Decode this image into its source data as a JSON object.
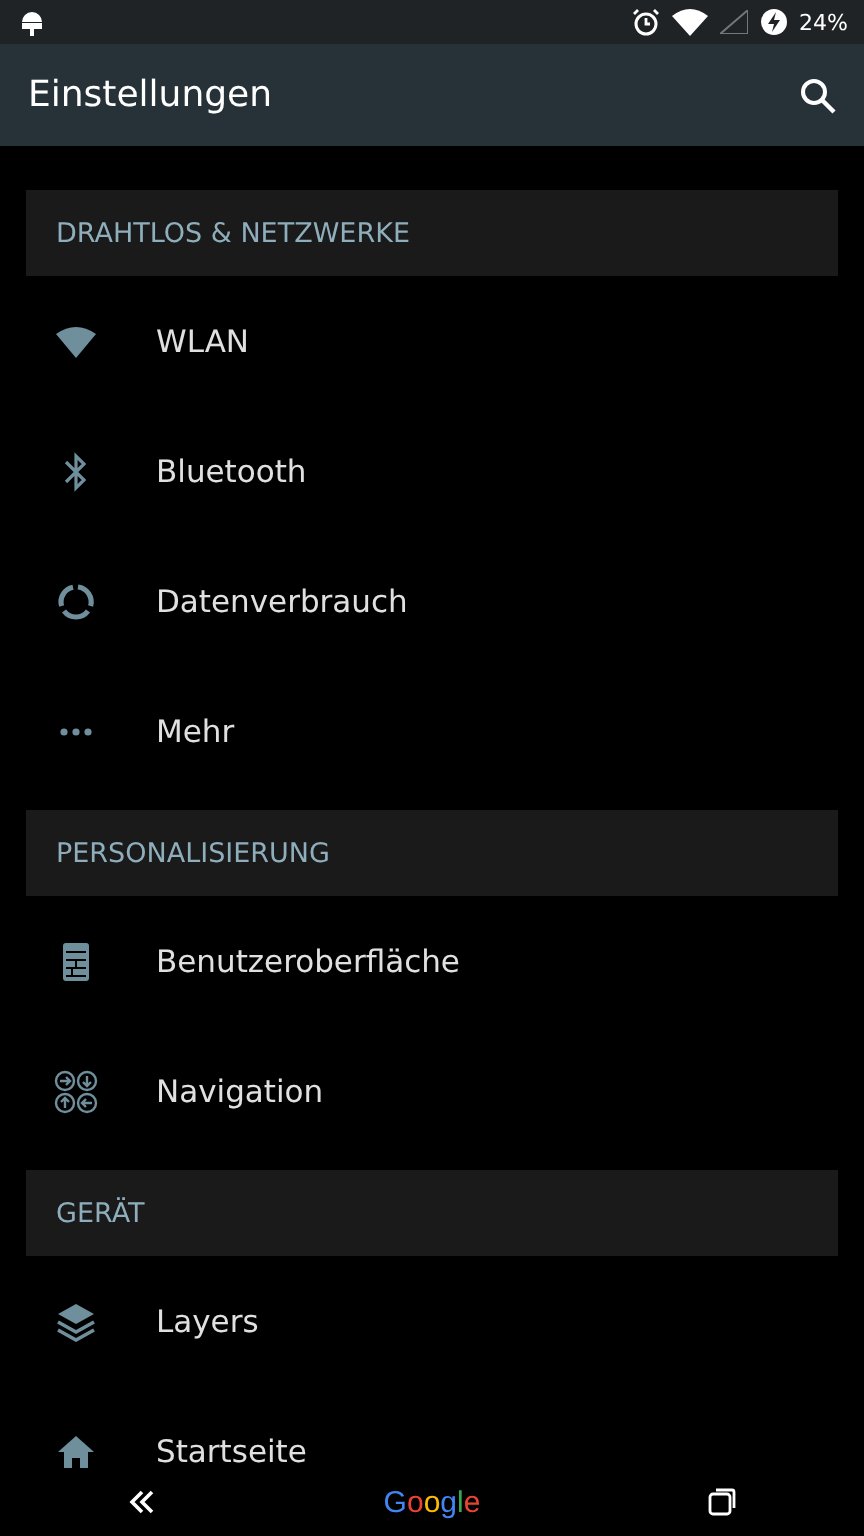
{
  "status_bar": {
    "battery": "24%"
  },
  "toolbar": {
    "title": "Einstellungen"
  },
  "sections": [
    {
      "title": "DRAHTLOS & NETZWERKE",
      "items": [
        {
          "label": "WLAN",
          "kind": "wifi"
        },
        {
          "label": "Bluetooth",
          "kind": "bluetooth"
        },
        {
          "label": "Datenverbrauch",
          "kind": "data"
        },
        {
          "label": "Mehr",
          "kind": "more"
        }
      ]
    },
    {
      "title": "PERSONALISIERUNG",
      "items": [
        {
          "label": "Benutzeroberfläche",
          "kind": "ui"
        },
        {
          "label": "Navigation",
          "kind": "navigation"
        }
      ]
    },
    {
      "title": "GERÄT",
      "items": [
        {
          "label": "Layers",
          "kind": "layers"
        },
        {
          "label": "Startseite",
          "kind": "home"
        }
      ]
    }
  ],
  "nav_bar": {
    "logo": "Google"
  }
}
